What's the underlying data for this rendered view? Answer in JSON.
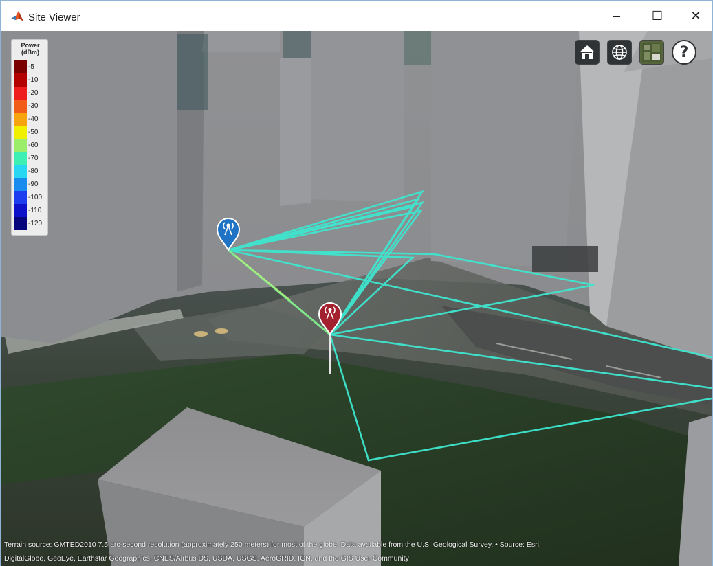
{
  "window": {
    "title": "Site Viewer",
    "minimize_glyph": "–",
    "maximize_glyph": "☐",
    "close_glyph": "✕"
  },
  "legend": {
    "title_line1": "Power",
    "title_line2": "(dBm)",
    "entries": [
      {
        "label": "-5",
        "color": "#7a0000"
      },
      {
        "label": "-10",
        "color": "#b30000"
      },
      {
        "label": "-20",
        "color": "#ee1c1c"
      },
      {
        "label": "-30",
        "color": "#f25c19"
      },
      {
        "label": "-40",
        "color": "#f7a40e"
      },
      {
        "label": "-50",
        "color": "#f0f000"
      },
      {
        "label": "-60",
        "color": "#9cee6a"
      },
      {
        "label": "-70",
        "color": "#3ef0b4"
      },
      {
        "label": "-80",
        "color": "#28d8f2"
      },
      {
        "label": "-90",
        "color": "#1a8cf0"
      },
      {
        "label": "-100",
        "color": "#1c3cf0"
      },
      {
        "label": "-110",
        "color": "#0c10c8"
      },
      {
        "label": "-120",
        "color": "#06047c"
      }
    ]
  },
  "toolbar": [
    {
      "name": "home-icon",
      "tooltip": "home"
    },
    {
      "name": "globe-icon",
      "tooltip": "globe"
    },
    {
      "name": "basemap-icon",
      "tooltip": "basemap"
    },
    {
      "name": "help-icon",
      "tooltip": "help"
    }
  ],
  "sites": {
    "transmitter": {
      "color": "#1f73c4"
    },
    "receiver": {
      "color": "#a3202e"
    }
  },
  "ray_color": "#3ee6cf",
  "credits": {
    "line1": "Terrain source: GMTED2010 7.5 arc-second resolution (approximately 250 meters) for most of the globe. Data available from the U.S. Geological Survey. • Source: Esri,",
    "line2": "DigitalGlobe, GeoEye, Earthstar Geographics, CNES/Airbus DS, USDA, USGS, AeroGRID, IGN, and the GIS User Community"
  }
}
